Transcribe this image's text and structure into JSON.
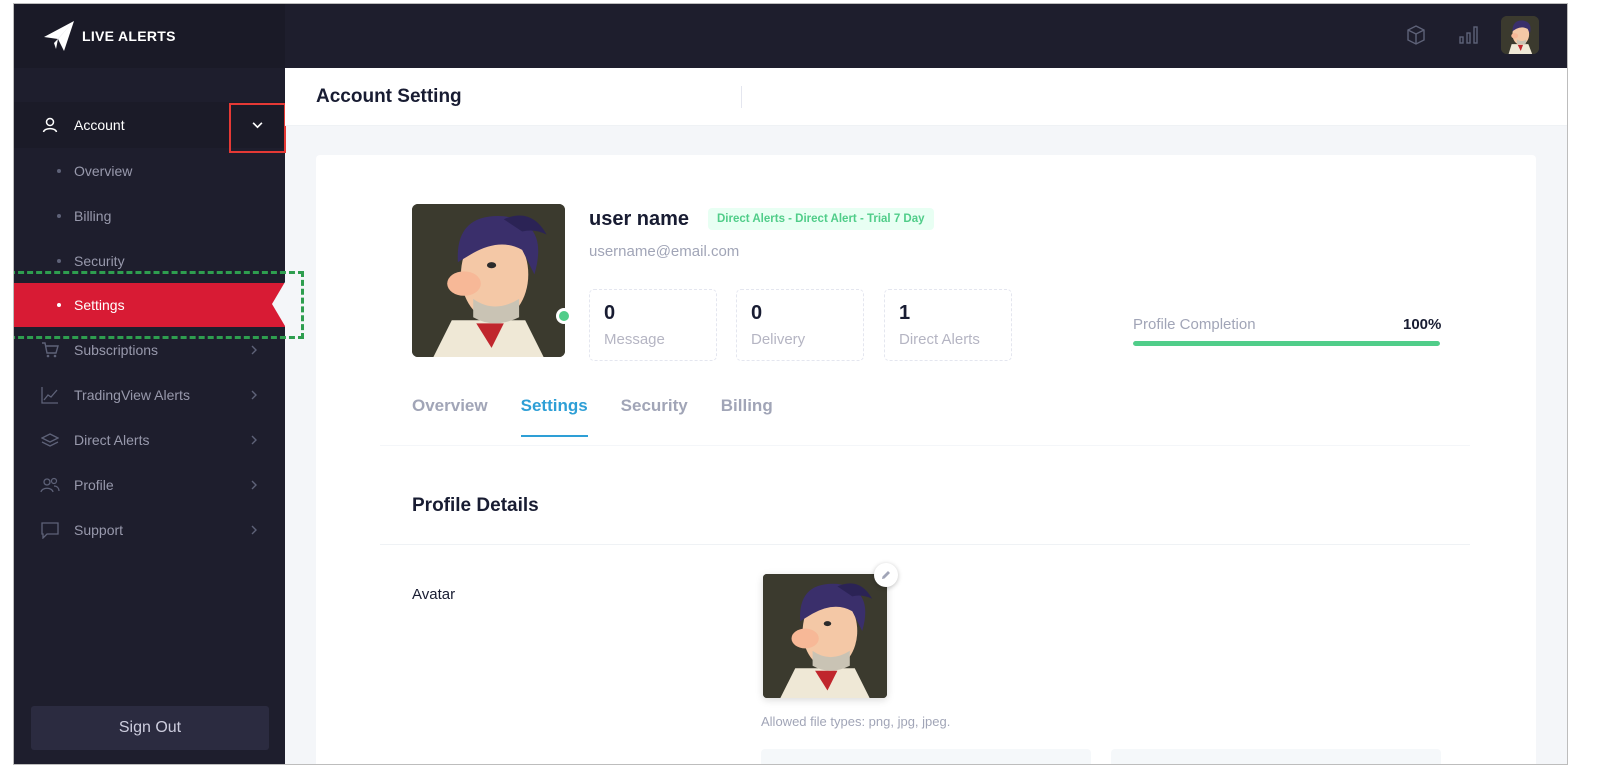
{
  "brand": {
    "name": "LIVE ALERTS"
  },
  "header": {
    "title": "Account Setting"
  },
  "sidebar": {
    "account_label": "Account",
    "sub_items": [
      {
        "label": "Overview"
      },
      {
        "label": "Billing"
      },
      {
        "label": "Security"
      },
      {
        "label": "Settings",
        "active": true
      }
    ],
    "items": [
      {
        "label": "Subscriptions",
        "icon": "cart-icon"
      },
      {
        "label": "TradingView Alerts",
        "icon": "chart-line-icon"
      },
      {
        "label": "Direct Alerts",
        "icon": "layers-icon"
      },
      {
        "label": "Profile",
        "icon": "users-icon"
      },
      {
        "label": "Support",
        "icon": "chat-icon"
      }
    ],
    "signout_label": "Sign Out"
  },
  "profile": {
    "name": "user name",
    "plan_badge": "Direct Alerts - Direct Alert - Trial 7 Day",
    "email": "username@email.com",
    "stats": [
      {
        "value": "0",
        "label": "Message"
      },
      {
        "value": "0",
        "label": "Delivery"
      },
      {
        "value": "1",
        "label": "Direct Alerts"
      }
    ],
    "completion_label": "Profile Completion",
    "completion_value": "100%",
    "completion_fraction": 1.0
  },
  "tabs": [
    {
      "label": "Overview"
    },
    {
      "label": "Settings",
      "active": true
    },
    {
      "label": "Security"
    },
    {
      "label": "Billing"
    }
  ],
  "details": {
    "title": "Profile Details",
    "avatar_label": "Avatar",
    "file_hint": "Allowed file types: png, jpg, jpeg."
  },
  "colors": {
    "sidebar_bg": "#1e1e2d",
    "active_red": "#d81b34",
    "success_green": "#50cd89",
    "tab_blue": "#2e9fd6"
  }
}
